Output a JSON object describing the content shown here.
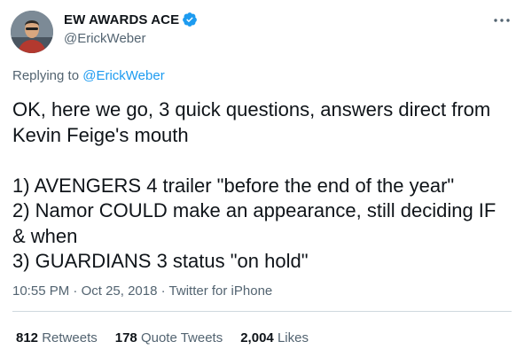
{
  "author": {
    "display_name": "EW AWARDS ACE",
    "handle": "@ErickWeber",
    "verified_icon": "verified-badge-icon",
    "accent_color": "#1d9bf0"
  },
  "reply": {
    "prefix": "Replying to",
    "target": "@ErickWeber"
  },
  "tweet": {
    "lines": [
      "OK, here we go, 3 quick questions, answers direct from",
      "Kevin Feige's mouth",
      "1) AVENGERS 4 trailer \"before the end of the year\"",
      "2) Namor COULD make an appearance, still deciding IF",
      "& when",
      "3) GUARDIANS 3 status \"on hold\""
    ]
  },
  "meta": {
    "time": "10:55 PM",
    "date": "Oct 25, 2018",
    "source": "Twitter for iPhone",
    "separator": "·"
  },
  "stats": {
    "retweets_count": "812",
    "retweets_label": "Retweets",
    "quotes_count": "178",
    "quotes_label": "Quote Tweets",
    "likes_count": "2,004",
    "likes_label": "Likes"
  },
  "icons": {
    "more": "more-options-icon",
    "avatar": "avatar"
  }
}
